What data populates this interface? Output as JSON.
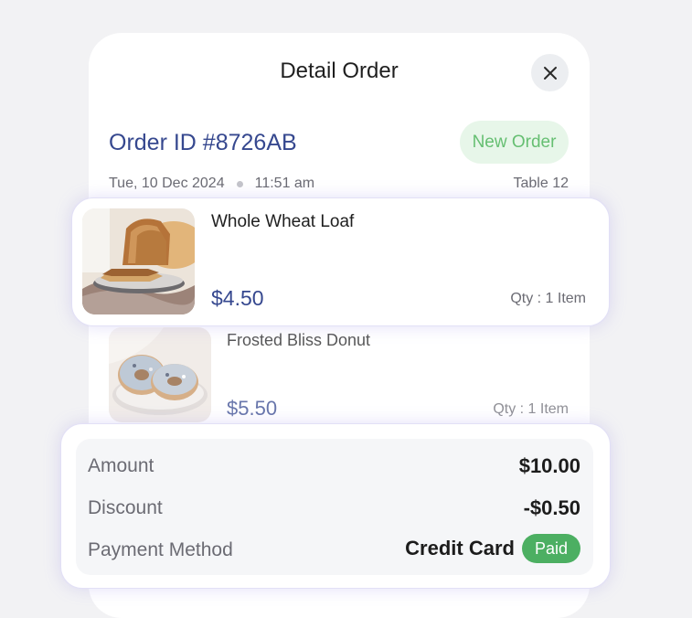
{
  "modal": {
    "title": "Detail Order",
    "close_icon": "close-icon"
  },
  "order": {
    "id": "Order ID #8726AB",
    "status": "New Order",
    "date": "Tue, 10 Dec 2024",
    "time": "11:51 am",
    "table": "Table 12"
  },
  "items": [
    {
      "name": "Whole Wheat Loaf",
      "price": "$4.50",
      "qty": "Qty : 1 Item",
      "image_icon": "bread-icon"
    },
    {
      "name": "Frosted Bliss Donut",
      "price": "$5.50",
      "qty": "Qty : 1 Item",
      "image_icon": "donut-icon"
    }
  ],
  "summary": {
    "amount_label": "Amount",
    "amount_value": "$10.00",
    "discount_label": "Discount",
    "discount_value": "-$0.50",
    "payment_label": "Payment Method",
    "payment_value": "Credit Card",
    "payment_status": "Paid"
  },
  "colors": {
    "accent": "#36488f",
    "new_badge_bg": "#e7f6e9",
    "new_badge_text": "#66bf72",
    "paid_bg": "#4caf62"
  }
}
